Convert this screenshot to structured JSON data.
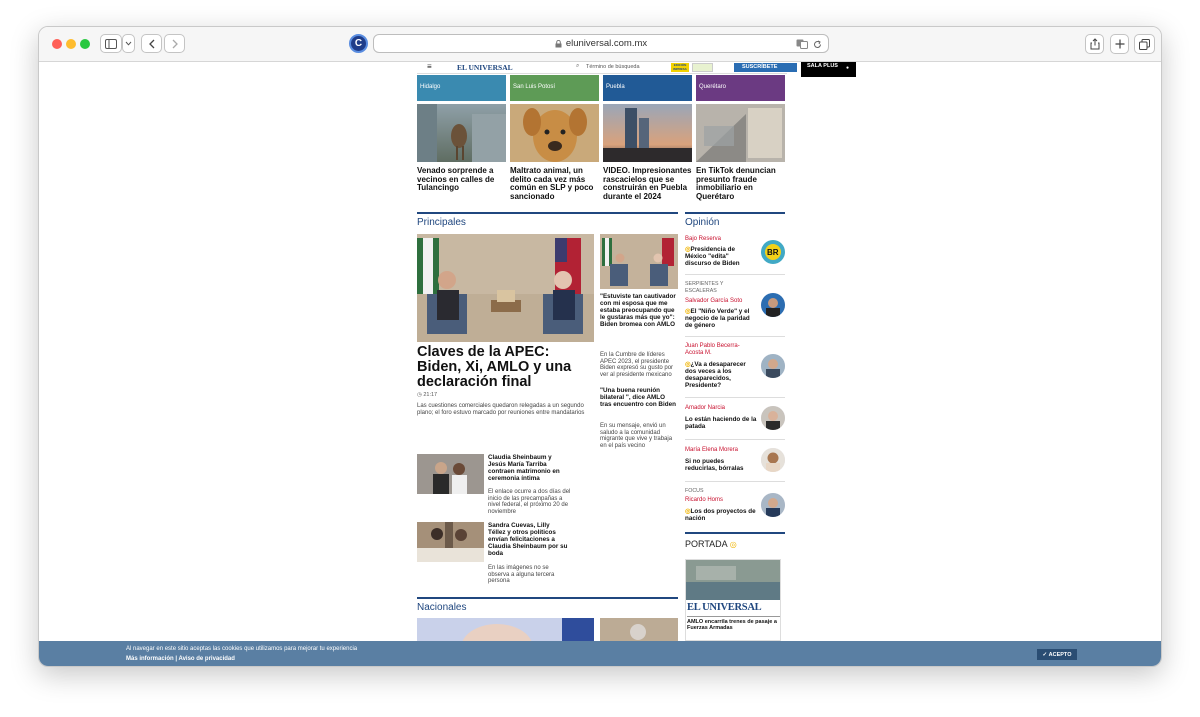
{
  "browser": {
    "url": "eluniversal.com.mx",
    "colors": {
      "close": "#ff5f57",
      "minimize": "#febc2e",
      "zoom": "#28c840"
    }
  },
  "site": {
    "logo": "EL UNIVERSAL",
    "search_placeholder": "Término de búsqueda",
    "edition_label": "EDICIÓN IMPRESA",
    "subscribe_label": "SUSCRÍBETE",
    "sala_plus_label": "SALA PLUS"
  },
  "states": [
    {
      "label": "Hidalgo",
      "color": "#3a8ab0",
      "headline": "Venado sorprende a vecinos en calles de Tulancingo"
    },
    {
      "label": "San Luis Potosí",
      "color": "#5e9b56",
      "headline": "Maltrato animal, un delito cada vez más común en SLP y poco sancionado"
    },
    {
      "label": "Puebla",
      "color": "#215a96",
      "headline": "VIDEO. Impresionantes rascacielos que se construirán en Puebla durante el 2024"
    },
    {
      "label": "Querétaro",
      "color": "#6b3a82",
      "headline": "En TikTok denuncian presunto fraude inmobiliario en Querétaro"
    }
  ],
  "principales": {
    "section_title": "Principales",
    "main": {
      "title": "Claves de la APEC: Biden, Xi, AMLO y una declaración final",
      "time": "21:17",
      "summary": "Las cuestiones comerciales quedaron relegadas a un segundo plano; el foro estuvo marcado por reuniones entre mandatarios"
    },
    "side": [
      {
        "headline": "\"Estuviste tan cautivador con mi esposa que me estaba preocupando que le gustaras más que yo\": Biden bromea con AMLO",
        "summary": "En la Cumbre de líderes APEC 2023, el presidente Biden expresó su gusto por ver al presidente mexicano"
      },
      {
        "headline": "\"Una buena reunión bilateral \", dice AMLO tras encuentro con Biden",
        "summary": "En su mensaje, envió un saludo a la comunidad migrante que vive y trabaja en el país vecino"
      }
    ],
    "list": [
      {
        "headline": "Claudia Sheinbaum y Jesús María Tarriba contraen matrimonio en ceremonia íntima",
        "summary": "El enlace ocurre a dos días del inicio de las precampañas a nivel federal, el próximo 20 de noviembre"
      },
      {
        "headline": "Sandra Cuevas, Lilly Téllez y otros políticos envían felicitaciones a Claudia Sheinbaum por su boda",
        "summary": "En las imágenes no se observa a alguna tercera persona"
      }
    ]
  },
  "opinion": {
    "section_title": "Opinión",
    "items": [
      {
        "column": "",
        "author": "Bajo Reserva",
        "title": "Presidencia de México \"edita\" discurso de Biden",
        "has_icon": true
      },
      {
        "column": "SERPIENTES Y ESCALERAS",
        "author": "Salvador García Soto",
        "title": "El \"Niño Verde\" y el negocio de la paridad de género",
        "has_icon": true
      },
      {
        "column": "",
        "author": "Juan Pablo Becerra-Acosta M.",
        "title": "¿Va a desaparecer dos veces a los desaparecidos, Presidente?",
        "has_icon": true
      },
      {
        "column": "",
        "author": "Amador Narcia",
        "title": "Lo están haciendo de la patada",
        "has_icon": false
      },
      {
        "column": "",
        "author": "María Elena Morera",
        "title": "Si no puedes reducirlas, bórralas",
        "has_icon": false
      },
      {
        "column": "FOCUS",
        "author": "Ricardo Homs",
        "title": "Los dos proyectos de nación",
        "has_icon": true
      }
    ],
    "portada_label": "PORTADA",
    "portada_logo": "EL UNIVERSAL",
    "portada_headline": "AMLO encarrila trenes de pasaje a Fuerzas Armadas"
  },
  "nacionales": {
    "section_title": "Nacionales"
  },
  "cookie": {
    "text": "Al navegar en este sitio aceptas las cookies que utilizamos para mejorar tu experiencia",
    "links": "Más información | Aviso de privacidad",
    "accept": "ACEPTO"
  }
}
